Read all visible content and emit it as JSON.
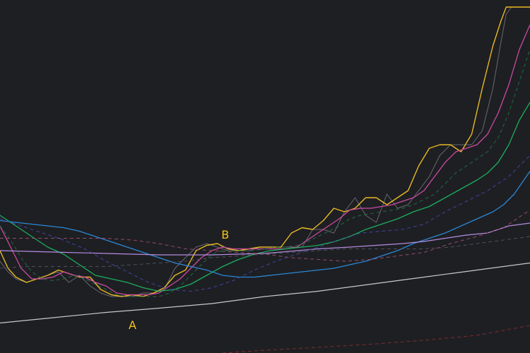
{
  "chart_data": {
    "type": "line",
    "title": "",
    "xlabel": "",
    "ylabel": "",
    "grid": false,
    "legend": "none",
    "xlim": [
      0,
      100
    ],
    "ylim": [
      0,
      100
    ],
    "background": "#1e1f23",
    "annotations": [
      {
        "label": "A",
        "x": 25,
        "y": 8,
        "color": "#f5c518"
      },
      {
        "label": "B",
        "x": 42.5,
        "y": 33.6,
        "color": "#f5c518"
      }
    ],
    "series": [
      {
        "color": "#7a7a82",
        "style": "solid",
        "width": 1,
        "opacity": 0.8,
        "x": [
          0,
          1.5,
          3,
          5,
          7,
          9,
          11,
          13,
          15,
          17,
          19,
          21,
          23,
          25,
          27,
          29,
          31,
          33,
          35,
          37,
          39,
          41,
          43,
          45,
          47,
          49,
          51,
          53,
          55,
          57,
          59,
          61,
          63,
          65,
          67,
          69,
          71,
          73,
          75,
          77,
          79,
          81,
          83,
          85,
          87,
          89,
          91,
          93,
          94.5,
          95.5,
          96.5,
          98,
          100
        ],
        "y": [
          26,
          23,
          21,
          20,
          21,
          22,
          23,
          20,
          22,
          19,
          17,
          16,
          16,
          16,
          17,
          17,
          18,
          24,
          27,
          30,
          31,
          30,
          29,
          29,
          29,
          30,
          30,
          30,
          30,
          30,
          35,
          35,
          34,
          40,
          44,
          39,
          37,
          45,
          41,
          42,
          46,
          50,
          56,
          59,
          59,
          59,
          63,
          75,
          88,
          96,
          98,
          98,
          98
        ]
      },
      {
        "color": "#e8b923",
        "style": "solid",
        "width": 1.4,
        "opacity": 1,
        "x": [
          0,
          1.5,
          3,
          5,
          7,
          9,
          11,
          13,
          15,
          17,
          19,
          21,
          23,
          25,
          27,
          29,
          31,
          33,
          35,
          37,
          39,
          41,
          43,
          45,
          47,
          49,
          51,
          53,
          55,
          57,
          59,
          61,
          63,
          65,
          67,
          69,
          71,
          73,
          75,
          77,
          79,
          81,
          83,
          85,
          87,
          89,
          91,
          93,
          94.5,
          95.5,
          96.5,
          98,
          100
        ],
        "y": [
          29,
          24,
          21.5,
          20,
          21,
          22,
          23.5,
          22.5,
          21.5,
          21.5,
          18,
          16.5,
          16,
          16.5,
          16,
          17,
          18.5,
          22,
          23.5,
          29,
          30.5,
          31,
          29.5,
          29,
          29.5,
          30,
          30,
          30,
          34,
          35.5,
          35,
          37.5,
          41,
          40,
          41,
          44,
          44,
          42,
          44,
          46,
          53,
          58,
          59,
          59,
          57,
          62,
          75,
          87,
          94,
          98,
          98,
          98,
          98
        ]
      },
      {
        "color": "#cc4aa1",
        "style": "solid",
        "width": 1.3,
        "opacity": 1,
        "x": [
          0,
          2,
          4,
          6,
          8,
          10,
          12,
          14,
          16,
          18,
          20,
          22,
          24,
          26,
          28,
          30,
          32,
          34,
          36,
          38,
          40,
          42,
          44,
          46,
          48,
          50,
          52,
          54,
          56,
          58,
          60,
          62,
          64,
          66,
          68,
          70,
          72,
          74,
          76,
          78,
          80,
          82,
          84,
          86,
          88,
          90,
          92,
          94,
          96,
          98,
          100
        ],
        "y": [
          36,
          30,
          24,
          21,
          21,
          21.5,
          23,
          22,
          21.5,
          20,
          19,
          17,
          16.5,
          16.5,
          16.5,
          17,
          19,
          21,
          24,
          27,
          29,
          30,
          29.5,
          29.5,
          29.5,
          29.5,
          29.5,
          29.5,
          30,
          32,
          34,
          36,
          38,
          40.5,
          41,
          41,
          41.5,
          42,
          43,
          44,
          46,
          50,
          54,
          57,
          58,
          59,
          62,
          68,
          76,
          86,
          93
        ]
      },
      {
        "color": "#1cae5c",
        "style": "solid",
        "width": 1.3,
        "opacity": 1,
        "x": [
          0,
          3,
          6,
          9,
          12,
          15,
          18,
          21,
          24,
          27,
          30,
          33,
          36,
          39,
          42,
          45,
          48,
          51,
          54,
          57,
          60,
          63,
          66,
          69,
          72,
          75,
          78,
          81,
          84,
          87,
          90,
          92,
          94,
          96,
          98,
          100
        ],
        "y": [
          39,
          36,
          33,
          30,
          28,
          25,
          22,
          21,
          20,
          18.5,
          17.5,
          18,
          19.5,
          22,
          24.5,
          26.5,
          28,
          29,
          29.5,
          30,
          30.5,
          31.5,
          33,
          35,
          36.5,
          38,
          40,
          41.5,
          44,
          46.5,
          49,
          51,
          54,
          59,
          66,
          71
        ]
      },
      {
        "color": "#2a87d6",
        "style": "solid",
        "width": 1.3,
        "opacity": 1,
        "x": [
          0,
          3,
          6,
          9,
          12,
          15,
          18,
          21,
          24,
          27,
          30,
          33,
          36,
          39,
          42,
          45,
          48,
          51,
          54,
          57,
          60,
          63,
          66,
          69,
          72,
          75,
          78,
          81,
          84,
          87,
          90,
          93,
          95,
          97,
          100
        ],
        "y": [
          37.5,
          37,
          36.5,
          36,
          35.5,
          34.5,
          33,
          31.5,
          30,
          28.5,
          27,
          25.5,
          24.5,
          23.5,
          22,
          21.5,
          21.5,
          22,
          22.5,
          23,
          23.5,
          24,
          25,
          26,
          27.5,
          29,
          31,
          32.5,
          34,
          36,
          38,
          40,
          42,
          45,
          51.5
        ]
      },
      {
        "color": "#b48ce0",
        "style": "solid",
        "width": 1.2,
        "opacity": 1,
        "x": [
          0,
          10,
          20,
          30,
          40,
          50,
          60,
          66,
          72,
          76,
          80,
          84,
          88,
          92,
          96,
          100
        ],
        "y": [
          29,
          28.6,
          28.2,
          27.8,
          27.8,
          28.2,
          29.5,
          30,
          30.6,
          31,
          31.6,
          32.5,
          33.4,
          34,
          36,
          36.8
        ]
      },
      {
        "color": "#c8c8cc",
        "style": "solid",
        "width": 1.2,
        "opacity": 1,
        "x": [
          0,
          10,
          20,
          30,
          40,
          50,
          60,
          70,
          80,
          90,
          100
        ],
        "y": [
          8.5,
          10,
          11.5,
          12.7,
          14,
          16,
          17.5,
          19.5,
          21.5,
          23.5,
          25.5
        ]
      },
      {
        "color": "#a05070",
        "style": "dashed",
        "width": 1,
        "opacity": 0.9,
        "x": [
          0,
          5,
          10,
          15,
          20,
          25,
          30,
          35,
          40,
          45,
          50,
          55,
          60,
          65,
          70,
          75,
          80,
          85,
          90,
          95,
          100
        ],
        "y": [
          32.5,
          32.5,
          32.5,
          32.5,
          32.5,
          32,
          31,
          29.5,
          29,
          28.5,
          28,
          27,
          26.5,
          26,
          26.5,
          27.5,
          28.5,
          31,
          33,
          35.5,
          40.5
        ]
      },
      {
        "color": "#4a4ab5",
        "style": "dashed",
        "width": 1,
        "opacity": 0.85,
        "x": [
          0,
          4,
          8,
          12,
          16,
          20,
          24,
          28,
          32,
          36,
          40,
          44,
          48,
          52,
          56,
          60,
          64,
          68,
          72,
          76,
          80,
          84,
          88,
          92,
          96,
          100
        ],
        "y": [
          38,
          36,
          34,
          32,
          29.5,
          26,
          23,
          20,
          18,
          17.5,
          18.5,
          20.5,
          23.5,
          26,
          28,
          30,
          32,
          34,
          34.5,
          35,
          36.5,
          40,
          43,
          46,
          50,
          56
        ]
      },
      {
        "color": "#1e7a48",
        "style": "dashed",
        "width": 1,
        "opacity": 0.85,
        "x": [
          0,
          2,
          4,
          6,
          8,
          10,
          12,
          14,
          16,
          18,
          20,
          22,
          24,
          26,
          28,
          30,
          32,
          34,
          36,
          38,
          40,
          42,
          44,
          46,
          48,
          50,
          52,
          54,
          56,
          58,
          60,
          62,
          64,
          66,
          68,
          70,
          72,
          74,
          76,
          78,
          80,
          82,
          84,
          86,
          88,
          90,
          92,
          94,
          96,
          98,
          100
        ],
        "y": [
          36,
          32,
          27,
          23,
          21,
          20.5,
          21,
          22,
          21,
          19.5,
          18,
          16.5,
          16,
          16,
          16,
          16,
          17,
          19,
          22,
          25,
          28,
          29,
          29,
          29,
          29,
          29.5,
          30,
          30,
          30.5,
          31.5,
          33,
          34.5,
          36,
          38,
          39,
          39.5,
          40,
          40.5,
          41,
          42,
          43.5,
          45,
          48,
          51,
          53,
          55,
          57,
          61,
          68,
          77,
          86
        ]
      },
      {
        "color": "#555561",
        "style": "dashed",
        "width": 1,
        "opacity": 0.9,
        "x": [
          0,
          5,
          10,
          15,
          20,
          25,
          30,
          35,
          40,
          45,
          50,
          55,
          60,
          65,
          70,
          75,
          80,
          85,
          90,
          95,
          100
        ],
        "y": [
          24,
          24.5,
          24.5,
          24.5,
          24.5,
          25,
          25.5,
          26,
          27,
          27.5,
          28,
          28.5,
          29,
          29.5,
          29.5,
          29.5,
          29.5,
          30,
          31,
          32,
          33
        ]
      },
      {
        "color": "#8a2e2e",
        "style": "dashed",
        "width": 1,
        "opacity": 0.9,
        "x": [
          42,
          50,
          60,
          70,
          80,
          90,
          100
        ],
        "y": [
          0,
          0.8,
          1.6,
          2.5,
          3.6,
          5,
          7.8
        ]
      }
    ]
  }
}
